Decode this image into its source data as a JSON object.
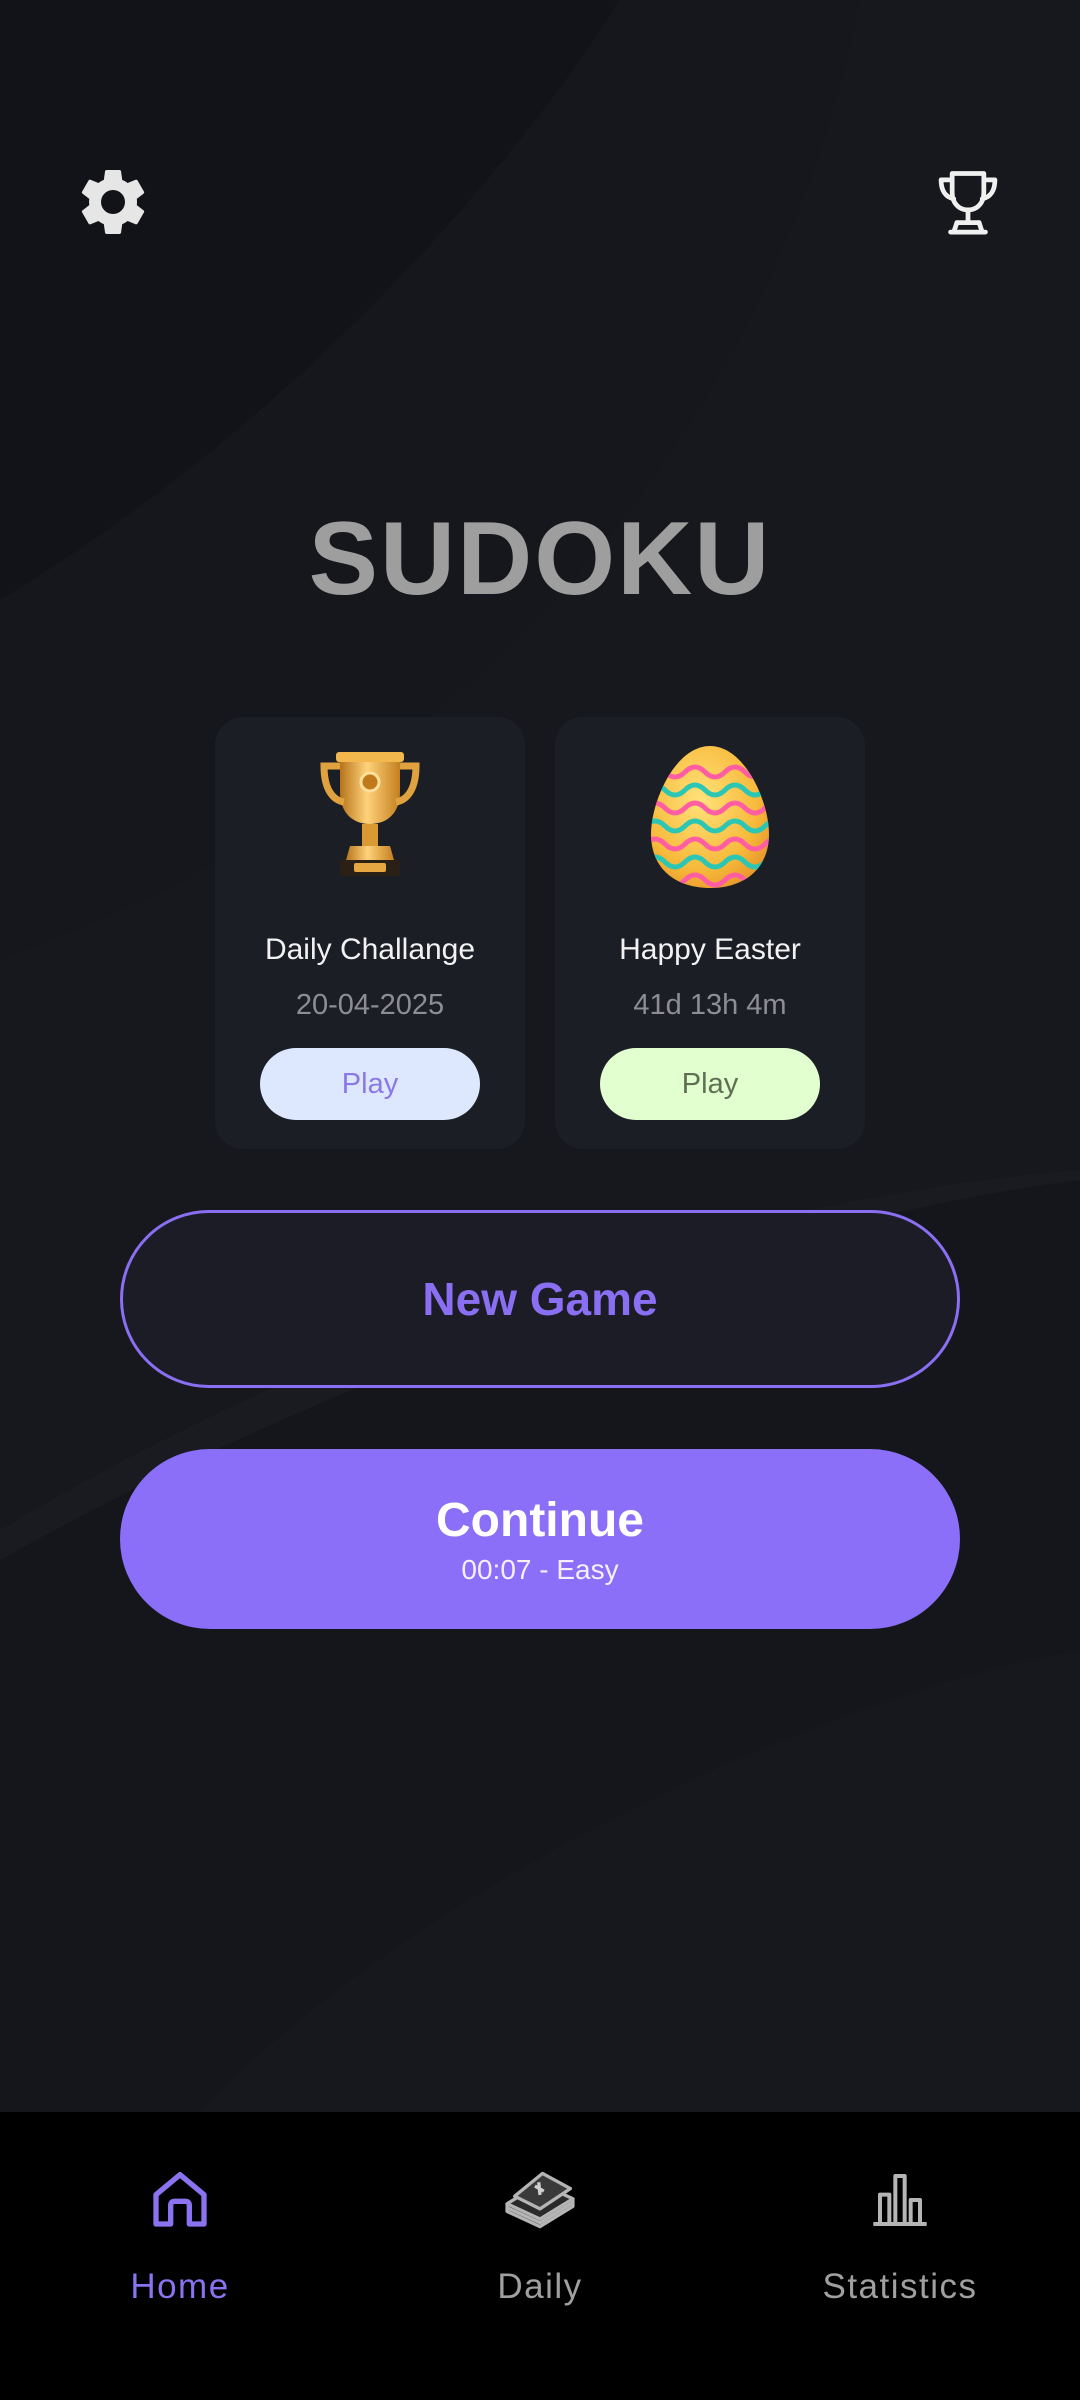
{
  "app": {
    "title": "SUDOKU"
  },
  "header": {
    "settings_icon": "gear-icon",
    "achievements_icon": "trophy-icon"
  },
  "cards": [
    {
      "title": "Daily Challange",
      "subtitle": "20-04-2025",
      "play_label": "Play",
      "icon": "gold-trophy-icon",
      "button_color": "#dde8ff"
    },
    {
      "title": "Happy Easter",
      "subtitle": "41d 13h 4m",
      "play_label": "Play",
      "icon": "easter-egg-icon",
      "button_color": "#e2ffcf"
    }
  ],
  "actions": {
    "new_game_label": "New Game",
    "continue_label": "Continue",
    "continue_sub": "00:07 - Easy"
  },
  "nav": {
    "items": [
      {
        "label": "Home",
        "icon": "home-icon",
        "active": true
      },
      {
        "label": "Daily",
        "icon": "calendar-icon",
        "active": false
      },
      {
        "label": "Statistics",
        "icon": "bar-chart-icon",
        "active": false
      }
    ]
  },
  "colors": {
    "accent": "#8b6ff8",
    "background": "#15161b",
    "card": "#1c1e25",
    "nav_bg": "#000000"
  }
}
